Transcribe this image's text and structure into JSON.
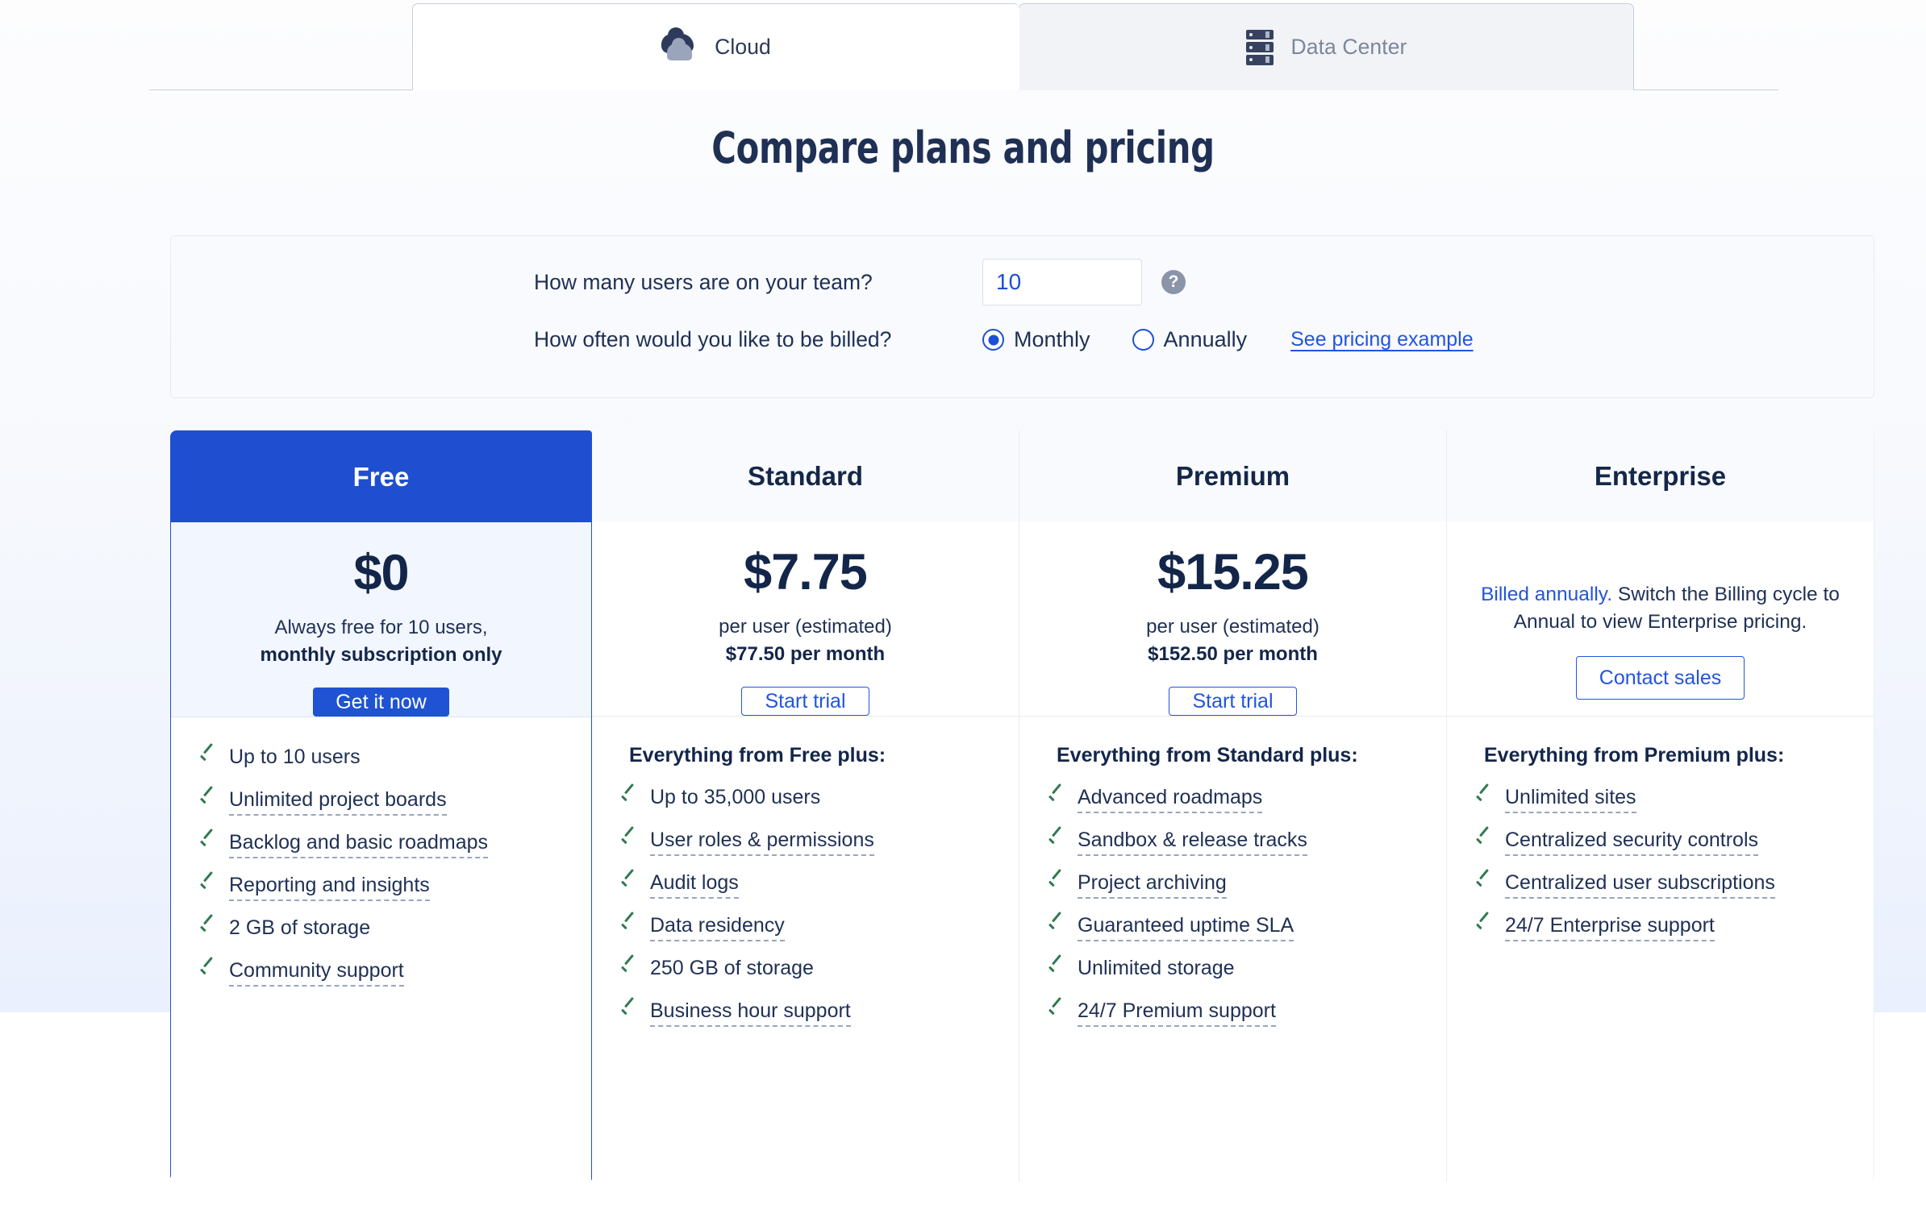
{
  "tabs": [
    {
      "id": "cloud",
      "label": "Cloud",
      "icon": "cloud-icon",
      "active": true
    },
    {
      "id": "datacenter",
      "label": "Data Center",
      "icon": "server-rack-icon",
      "active": false
    }
  ],
  "page": {
    "title": "Compare plans and pricing"
  },
  "calculator": {
    "users_question": "How many users are on your team?",
    "users_value": "10",
    "help_icon_glyph": "?",
    "billing_question": "How often would you like to be billed?",
    "billing_options": [
      {
        "label": "Monthly",
        "selected": true
      },
      {
        "label": "Annually",
        "selected": false
      }
    ],
    "pricing_example_link": "See pricing example"
  },
  "colors": {
    "accent_blue": "#1f53d3",
    "link_blue": "#2255dd",
    "heading_navy": "#1f3055",
    "check_green": "#2f7a4f",
    "free_header_bg": "#1f4fd0",
    "free_body_bg": "#f2f6fe",
    "header_bg": "#f8fafd"
  },
  "plans": [
    {
      "name": "Free",
      "highlighted": true,
      "price": "$0",
      "price_note_1": "Always free for 10 users,",
      "price_note_2": "monthly subscription only",
      "cta_label": "Get it now",
      "cta_style": "solid",
      "feature_heading": "",
      "features": [
        {
          "label": "Up to 10 users",
          "tooltip": false
        },
        {
          "label": "Unlimited project boards",
          "tooltip": true
        },
        {
          "label": "Backlog and basic roadmaps",
          "tooltip": true
        },
        {
          "label": "Reporting and insights",
          "tooltip": true
        },
        {
          "label": "2 GB of storage",
          "tooltip": false
        },
        {
          "label": "Community support",
          "tooltip": true
        }
      ]
    },
    {
      "name": "Standard",
      "highlighted": false,
      "price": "$7.75",
      "price_note_1": "per user (estimated)",
      "price_note_2": "$77.50 per month",
      "cta_label": "Start trial",
      "cta_style": "ghost",
      "feature_heading": "Everything from Free plus:",
      "features": [
        {
          "label": "Up to 35,000 users",
          "tooltip": false
        },
        {
          "label": "User roles & permissions",
          "tooltip": true
        },
        {
          "label": "Audit logs",
          "tooltip": true
        },
        {
          "label": "Data residency",
          "tooltip": true
        },
        {
          "label": "250 GB of storage",
          "tooltip": false
        },
        {
          "label": "Business hour support",
          "tooltip": true
        }
      ]
    },
    {
      "name": "Premium",
      "highlighted": false,
      "price": "$15.25",
      "price_note_1": "per user (estimated)",
      "price_note_2": "$152.50 per month",
      "cta_label": "Start trial",
      "cta_style": "ghost",
      "feature_heading": "Everything from Standard plus:",
      "features": [
        {
          "label": "Advanced roadmaps",
          "tooltip": true
        },
        {
          "label": "Sandbox & release tracks",
          "tooltip": true
        },
        {
          "label": "Project archiving",
          "tooltip": true
        },
        {
          "label": "Guaranteed uptime SLA",
          "tooltip": true
        },
        {
          "label": "Unlimited storage",
          "tooltip": false
        },
        {
          "label": "24/7 Premium support",
          "tooltip": true
        }
      ]
    },
    {
      "name": "Enterprise",
      "highlighted": false,
      "price": "",
      "note_highlight": "Billed annually.",
      "note_rest": " Switch the Billing cycle to Annual to view Enterprise pricing.",
      "cta_label": "Contact sales",
      "cta_style": "ghost",
      "feature_heading": "Everything from Premium plus:",
      "features": [
        {
          "label": "Unlimited sites",
          "tooltip": true
        },
        {
          "label": "Centralized security controls",
          "tooltip": true
        },
        {
          "label": "Centralized user subscriptions",
          "tooltip": true
        },
        {
          "label": "24/7 Enterprise support",
          "tooltip": true
        }
      ]
    }
  ]
}
